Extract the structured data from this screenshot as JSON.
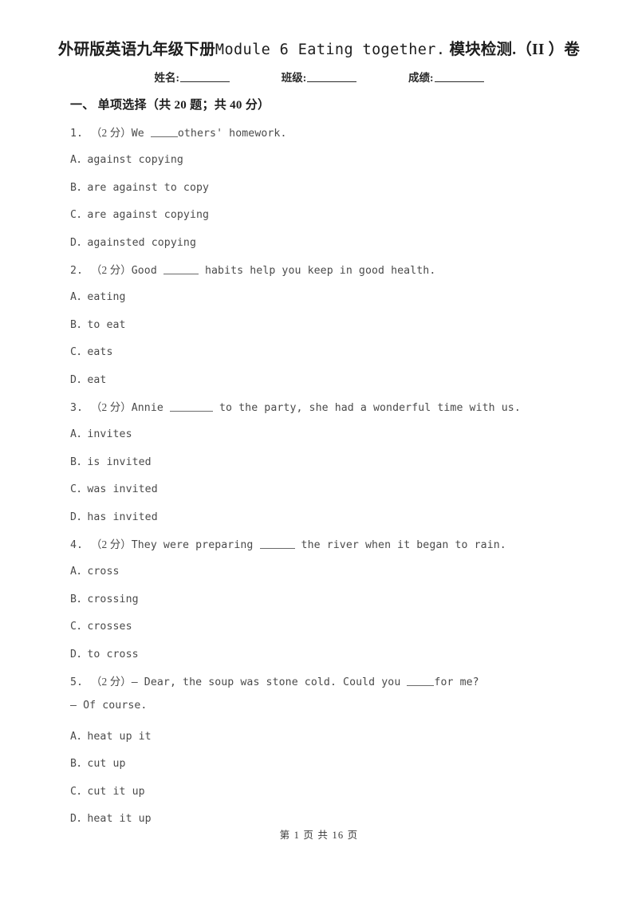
{
  "document": {
    "title_prefix_cjk": "外研版英语九年级下册",
    "title_latin": "Module 6 Eating together.",
    "title_suffix_cjk": "模块检测.（II ）卷",
    "title_full": "外研版英语九年级下册Module 6 Eating together. 模块检测.（II ）卷"
  },
  "info": {
    "name_label": "姓名:",
    "class_label": "班级:",
    "score_label": "成绩:"
  },
  "section": {
    "heading": "一、 单项选择（共 20 题；共 40 分）"
  },
  "questions": [
    {
      "number": "1.",
      "score": "（2 分）",
      "stem_before": "We ",
      "blank": "b4",
      "stem_after": "others' homework.",
      "stem_line2": "",
      "options": [
        {
          "letter": "A．",
          "text": "against copying"
        },
        {
          "letter": "B．",
          "text": "are against to copy"
        },
        {
          "letter": "C．",
          "text": "are against copying"
        },
        {
          "letter": "D．",
          "text": "againsted copying"
        }
      ]
    },
    {
      "number": "2.",
      "score": "（2 分）",
      "stem_before": "Good ",
      "blank": "b5",
      "stem_after": " habits help you keep in good health.",
      "stem_line2": "",
      "options": [
        {
          "letter": "A．",
          "text": "eating"
        },
        {
          "letter": "B．",
          "text": "to eat"
        },
        {
          "letter": "C．",
          "text": "eats"
        },
        {
          "letter": "D．",
          "text": "eat"
        }
      ]
    },
    {
      "number": "3.",
      "score": "（2 分）",
      "stem_before": "Annie ",
      "blank": "b6",
      "stem_after": " to the party, she had a wonderful time with us.",
      "stem_line2": "",
      "options": [
        {
          "letter": "A．",
          "text": "invites"
        },
        {
          "letter": "B．",
          "text": "is invited"
        },
        {
          "letter": "C．",
          "text": "was invited"
        },
        {
          "letter": "D．",
          "text": "has invited"
        }
      ]
    },
    {
      "number": "4.",
      "score": "（2 分）",
      "stem_before": "They were preparing ",
      "blank": "b5",
      "stem_after": " the river when it began to rain.",
      "stem_line2": "",
      "options": [
        {
          "letter": "A．",
          "text": "cross"
        },
        {
          "letter": "B．",
          "text": "crossing"
        },
        {
          "letter": "C．",
          "text": "crosses"
        },
        {
          "letter": "D．",
          "text": "to cross"
        }
      ]
    },
    {
      "number": "5.",
      "score": "（2 分）",
      "stem_before": "— Dear, the soup was stone cold. Could you ",
      "blank": "b4",
      "stem_after": "for me?",
      "stem_line2": "— Of course.",
      "options": [
        {
          "letter": "A．",
          "text": "heat up it"
        },
        {
          "letter": "B．",
          "text": "cut up"
        },
        {
          "letter": "C．",
          "text": "cut it up"
        },
        {
          "letter": "D．",
          "text": "heat it up"
        }
      ]
    }
  ],
  "footer": {
    "text": "第 1 页 共 16 页"
  }
}
